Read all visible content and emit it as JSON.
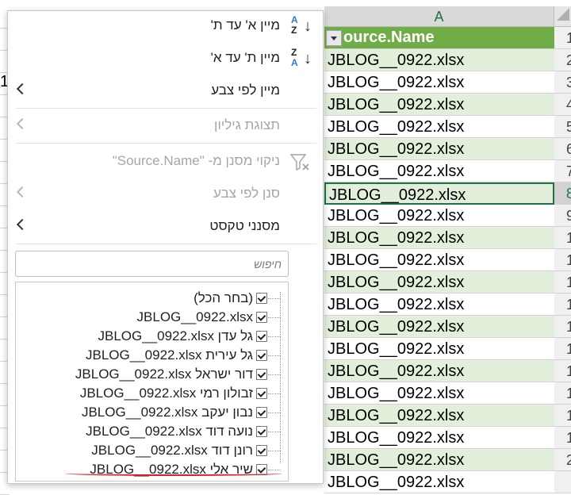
{
  "sheet": {
    "column_letter": "A",
    "header_text": "ource.Name",
    "cell_text": "JBLOG__0922.xlsx",
    "row_numbers": [
      "1",
      "2",
      "3",
      "4",
      "5",
      "6",
      "7",
      "8",
      "9",
      "1",
      "1",
      "1",
      "1",
      "1",
      "1",
      "1",
      "1",
      "1",
      "1",
      "2",
      ""
    ],
    "left_strip_char": "1",
    "colors": {
      "header_green": "#70ad47",
      "band_green": "#e2efda",
      "accent": "#217346"
    }
  },
  "menu": {
    "sort_az": {
      "label": "מיין א' עד ת'",
      "icon_top": "A",
      "icon_bottom": "Z",
      "icon": "sort-ascending-icon"
    },
    "sort_za": {
      "label": "מיין ת' עד א'",
      "icon_top": "Z",
      "icon_bottom": "A",
      "icon": "sort-descending-icon"
    },
    "sort_by_color": {
      "label": "מיין לפי צבע",
      "enabled": true
    },
    "sheet_view": {
      "label": "תצוגת גיליון",
      "enabled": false
    },
    "clear_filter": {
      "label": "ניקוי מסנן מ- \"Source.Name\"",
      "enabled": false,
      "icon": "clear-filter-icon"
    },
    "filter_by_color": {
      "label": "סנן לפי צבע",
      "enabled": false
    },
    "text_filters": {
      "label": "מסנני טקסט",
      "enabled": true
    },
    "search": {
      "placeholder": "חיפוש"
    },
    "items": [
      {
        "label": "(בחר הכל)",
        "checked": true
      },
      {
        "label": "JBLOG__0922.xlsx",
        "checked": true
      },
      {
        "label": "גל עדן JBLOG__0922.xlsx",
        "checked": true
      },
      {
        "label": "גל עירית JBLOG__0922.xlsx",
        "checked": true
      },
      {
        "label": "דור ישראל JBLOG__0922.xlsx",
        "checked": true
      },
      {
        "label": "זבולון רמי JBLOG__0922.xlsx",
        "checked": true
      },
      {
        "label": "נבון יעקב JBLOG__0922.xlsx",
        "checked": true
      },
      {
        "label": "נועה דוד JBLOG__0922.xlsx",
        "checked": true
      },
      {
        "label": "רונן דוד JBLOG__0922.xlsx",
        "checked": true
      },
      {
        "label": "שיר אלי JBLOG__0922.xlsx",
        "checked": true
      }
    ]
  }
}
